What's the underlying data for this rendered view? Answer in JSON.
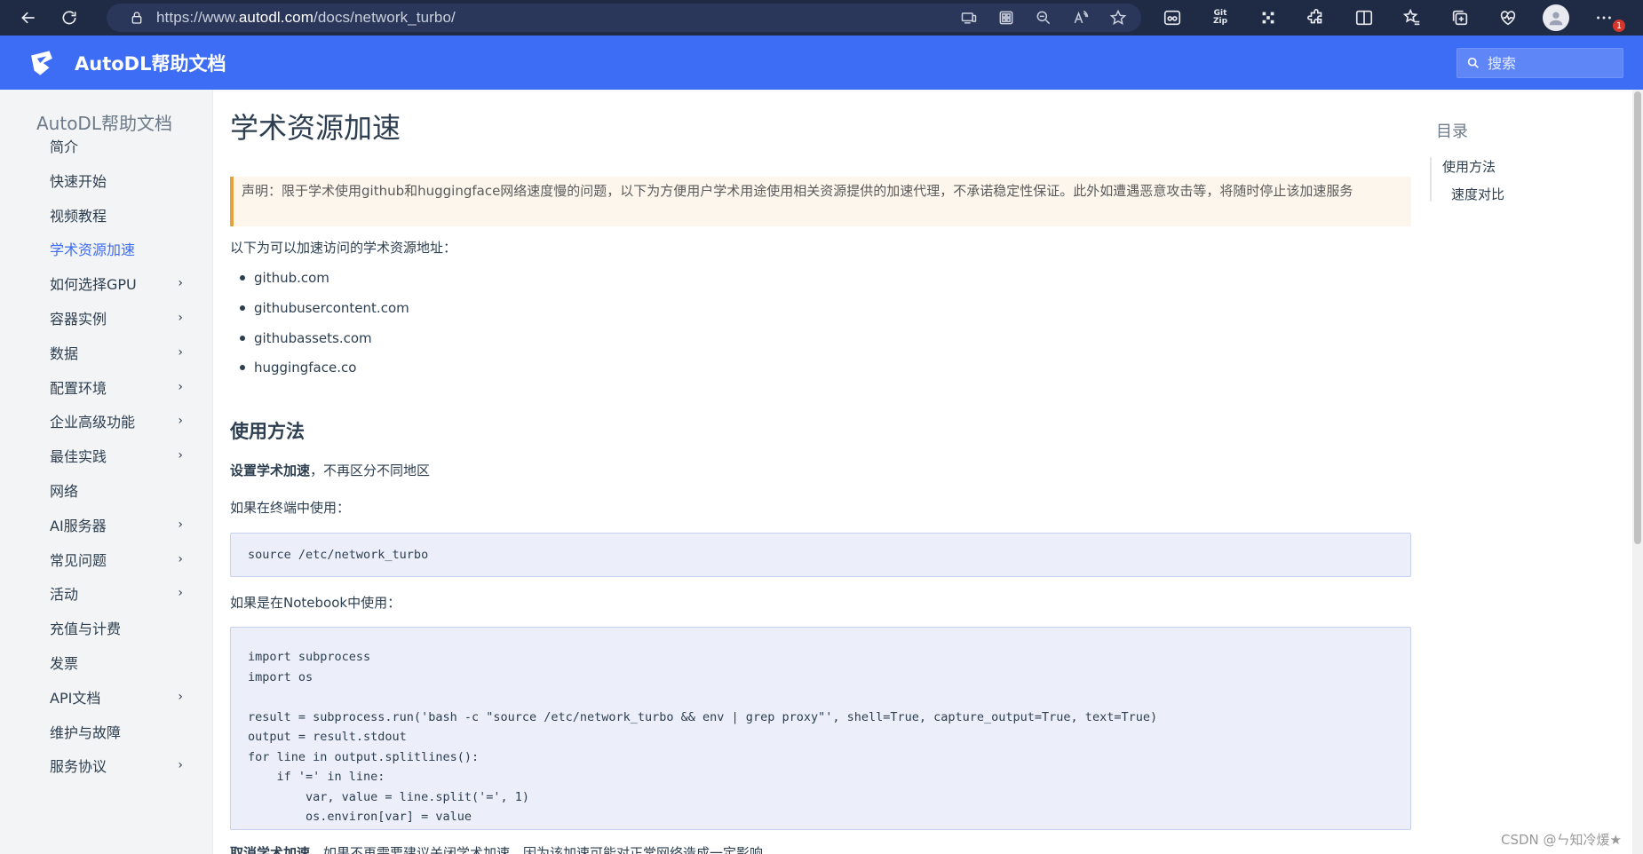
{
  "browser": {
    "url_prefix": "https://www.",
    "url_domain": "autodl.com",
    "url_path": "/docs/network_turbo/",
    "gitzip_top": "Git",
    "gitzip_bottom": "Zip",
    "notification_count": "1"
  },
  "header": {
    "site_title": "AutoDL帮助文档",
    "search_placeholder": "搜索"
  },
  "sidebar": {
    "heading": "AutoDL帮助文档",
    "items": [
      {
        "label": "简介",
        "has_children": false,
        "active": false
      },
      {
        "label": "快速开始",
        "has_children": false,
        "active": false
      },
      {
        "label": "视频教程",
        "has_children": false,
        "active": false
      },
      {
        "label": "学术资源加速",
        "has_children": false,
        "active": true
      },
      {
        "label": "如何选择GPU",
        "has_children": true,
        "active": false
      },
      {
        "label": "容器实例",
        "has_children": true,
        "active": false
      },
      {
        "label": "数据",
        "has_children": true,
        "active": false
      },
      {
        "label": "配置环境",
        "has_children": true,
        "active": false
      },
      {
        "label": "企业高级功能",
        "has_children": true,
        "active": false
      },
      {
        "label": "最佳实践",
        "has_children": true,
        "active": false
      },
      {
        "label": "网络",
        "has_children": false,
        "active": false
      },
      {
        "label": "AI服务器",
        "has_children": true,
        "active": false
      },
      {
        "label": "常见问题",
        "has_children": true,
        "active": false
      },
      {
        "label": "活动",
        "has_children": true,
        "active": false
      },
      {
        "label": "充值与计费",
        "has_children": false,
        "active": false
      },
      {
        "label": "发票",
        "has_children": false,
        "active": false
      },
      {
        "label": "API文档",
        "has_children": true,
        "active": false
      },
      {
        "label": "维护与故障",
        "has_children": false,
        "active": false
      },
      {
        "label": "服务协议",
        "has_children": true,
        "active": false
      }
    ],
    "chevron": "›"
  },
  "main": {
    "title": "学术资源加速",
    "notice": "声明：限于学术使用github和huggingface网络速度慢的问题，以下为方便用户学术用途使用相关资源提供的加速代理，不承诺稳定性保证。此外如遭遇恶意攻击等，将随时停止该加速服务",
    "intro": "以下为可以加速访问的学术资源地址：",
    "domains": [
      "github.com",
      "githubusercontent.com",
      "githubassets.com",
      "huggingface.co"
    ],
    "section_title": "使用方法",
    "setup_bold": "设置学术加速",
    "setup_rest": "，不再区分不同地区",
    "terminal_label": "如果在终端中使用：",
    "terminal_code": "source /etc/network_turbo",
    "notebook_label": "如果是在Notebook中使用：",
    "notebook_code": "import subprocess\nimport os\n\nresult = subprocess.run('bash -c \"source /etc/network_turbo && env | grep proxy\"', shell=True, capture_output=True, text=True)\noutput = result.stdout\nfor line in output.splitlines():\n    if '=' in line:\n        var, value = line.split('=', 1)\n        os.environ[var] = value",
    "cancel_bold": "取消学术加速",
    "cancel_rest": "，如果不再需要建议关闭学术加速，因为该加速可能对正常网络造成一定影响"
  },
  "toc": {
    "title": "目录",
    "items": [
      {
        "label": "使用方法",
        "level": 1
      },
      {
        "label": "速度对比",
        "level": 2
      }
    ]
  },
  "watermark": "CSDN @ㄣ知冷煖★"
}
